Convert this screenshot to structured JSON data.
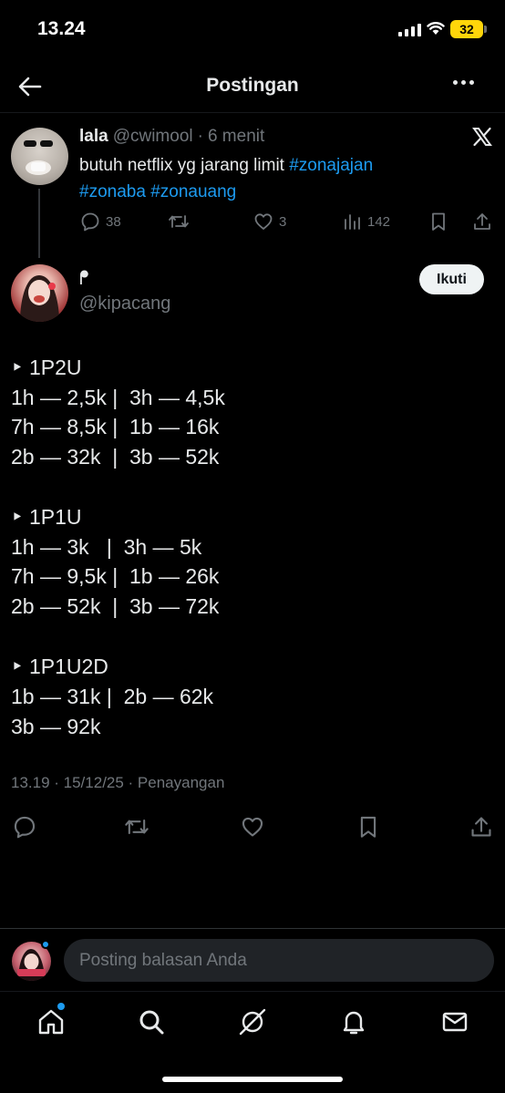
{
  "status_bar": {
    "time": "13.24",
    "battery": "32"
  },
  "header": {
    "title": "Postingan"
  },
  "parent_post": {
    "name": "lala",
    "handle": "@cwimool",
    "separator": "·",
    "time": "6 menit",
    "text_plain": "butuh netflix yg jarang limit ",
    "hashtags": [
      "#zonajajan",
      "#zonaba",
      "#zonauang"
    ],
    "replies": "38",
    "likes": "3",
    "views": "142"
  },
  "main_post": {
    "display_name": "ᖰ",
    "handle": "@kipacang",
    "follow_label": "Ikuti",
    "lines": [
      "‣ 1P2U",
      "1h — 2,5k |  3h — 4,5k",
      "7h — 8,5k |  1b — 16k",
      "2b — 32k  |  3b — 52k",
      "",
      "‣ 1P1U",
      "1h — 3k   |  3h — 5k",
      "7h — 9,5k |  1b — 26k",
      "2b — 52k  |  3b — 72k",
      "",
      "‣ 1P1U2D",
      "1b — 31k |  2b — 62k",
      "3b — 92k"
    ],
    "meta": "13.19 · 15/12/25 · Penayangan"
  },
  "reply_bar": {
    "placeholder": "Posting balasan Anda"
  },
  "colors": {
    "background": "#000000",
    "text": "#e7e9ea",
    "muted": "#71767b",
    "accent": "#1d9bf0"
  },
  "icons": [
    "back-arrow-icon",
    "more-icon",
    "x-logo-icon",
    "reply-icon",
    "repost-icon",
    "like-icon",
    "views-icon",
    "bookmark-icon",
    "share-icon",
    "home-icon",
    "search-icon",
    "grok-icon",
    "notifications-icon",
    "messages-icon"
  ]
}
